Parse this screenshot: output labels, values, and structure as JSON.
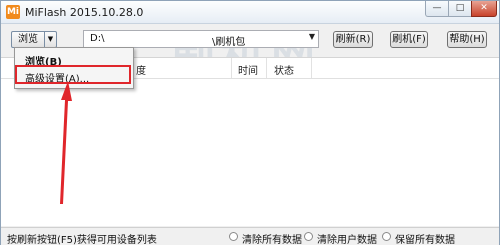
{
  "window": {
    "title": "MiFlash 2015.10.28.0",
    "icon_label": "Mi",
    "minimize": "—",
    "maximize": "□",
    "close": "✕"
  },
  "watermark": {
    "big": "刷机网",
    "small": "ShuaJi.com"
  },
  "toolbar": {
    "browse_label": "浏览(B)",
    "browse_drop": "▼",
    "path_prefix": "D:\\",
    "path_suffix": "\\刷机包",
    "path_arrow": "▼",
    "refresh_label": "刷新(R)",
    "flash_label": "刷机(F)",
    "help_label": "帮助(H)"
  },
  "list": {
    "columns": [
      "度",
      "时间",
      "状态"
    ]
  },
  "menu": {
    "items": [
      "浏览(B)",
      "高级设置(A)..."
    ]
  },
  "status": {
    "text": "按刷新按钮(F5)获得可用设备列表",
    "options": [
      "清除所有数据",
      "清除用户数据",
      "保留所有数据"
    ]
  },
  "colors": {
    "annotation": "#e0262b",
    "accent": "#3c7fb1"
  }
}
